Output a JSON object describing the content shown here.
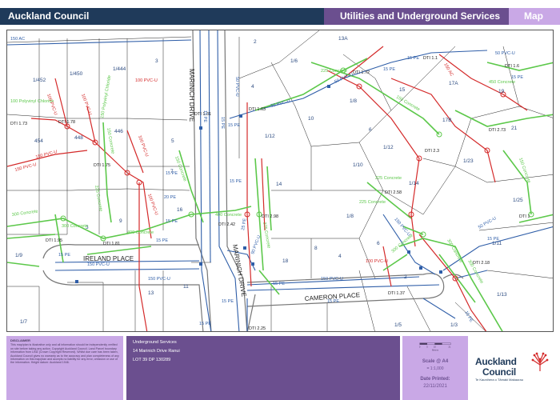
{
  "header": {
    "org": "Auckland Council",
    "title": "Utilities and Underground Services",
    "tag": "Map"
  },
  "map": {
    "roads": [
      "MARINICH DRIVE",
      "MARINICH DRIVE",
      "IRELAND PLACE",
      "CAMERON PLACE"
    ],
    "parcels": [
      "13A",
      "2",
      "1/6",
      "1/452",
      "1/450",
      "1/444",
      "3",
      "4",
      "1/8",
      "15",
      "17A",
      "17B",
      "19",
      "1/12",
      "10",
      "6",
      "21",
      "454",
      "448",
      "446",
      "5",
      "7",
      "1/23",
      "1/12",
      "1/10",
      "14",
      "16",
      "1/14",
      "1/25",
      "1/8",
      "9",
      "3",
      "18",
      "8",
      "6",
      "4",
      "2",
      "1/9",
      "13",
      "11",
      "1/11",
      "1/13",
      "1/5",
      "1/3",
      "1/7"
    ],
    "services": [
      "150 AC",
      "150 AC",
      "100 Polyvinyl Chloride",
      "100 PVC-U",
      "100 PVC-U",
      "100 PVC-U",
      "150 PVC-U",
      "150 PVC-U",
      "150 PVC-U",
      "100 PVC-U",
      "100 PVC-U",
      "100 PVC-U",
      "225 Concrete",
      "300 Concrete",
      "300 Concrete",
      "400 Concrete",
      "400 Concrete",
      "375 Concrete",
      "150 Concrete",
      "225 Concrete",
      "225 Concrete",
      "150 Concrete",
      "150 Concrete",
      "150 Concrete",
      "300 Concrete",
      "450 Concrete",
      "50 PVC-U",
      "50 PVC-U",
      "90 PVC-U",
      "150 Polyvinyl Chloride",
      "50 PVC-U",
      "15 PE",
      "15 PE",
      "15 PE",
      "15 PE",
      "15 PE",
      "15 PE",
      "15 PE",
      "15 PE",
      "15 PE",
      "15 PE",
      "15 PE",
      "15 PE",
      "15 PE",
      "15 PE",
      "15 PE",
      "15 PE",
      "15 PE",
      "20 PE",
      "25 PE",
      "150 PVC-U",
      "150 PVC-U",
      "150 PVC-U",
      "50 PVC-U",
      "50 PVC-U",
      "300 Concrete",
      "300 Concrete",
      "225 Concrete"
    ],
    "dti": [
      "DTI 1.78",
      "DTI 1.73",
      "DTI 1.75",
      "DTI 1.31",
      "DTI 1.63",
      "DTI 1.72",
      "DTI 1.1",
      "DTI 1.6",
      "DTI 2.73",
      "DTI 2.3",
      "DTI 2.58",
      "DTI 2.98",
      "DTI 2.42",
      "DTI 1.95",
      "DTI 1.81",
      "DTI 1.37",
      "DTI 2.18",
      "DTI 1",
      "DTI 2.25"
    ]
  },
  "footer": {
    "disclaimer_title": "DISCLAIMER",
    "disclaimer_text": "This map/plan is illustrative only and all information should be independently verified on site before taking any action. Copyright Auckland Council. Land Parcel boundary information from LINZ (Crown Copyright Reserved). Whilst due care has been taken, Auckland Council gives no warranty as to the accuracy and plan completeness of any information on this map/plan and accepts no liability for any error, omission or use of the information. Height datum: Auckland 1946.",
    "section_title": "Underground Services",
    "address": "14 Marinich Drive Ranui",
    "legal": "LOT 39 DP 130289",
    "scale_label": "Scale @ A4",
    "scale_value": "= 1:1,000",
    "scale_ticks": [
      "0",
      "5",
      "10",
      "21"
    ],
    "scale_units": "Meters",
    "date_label": "Date Printed:",
    "date_value": "22/11/2021",
    "logo_line1": "Auckland",
    "logo_line2": "Council",
    "logo_sub": "Te Kaunihera o Tāmaki Makaurau"
  },
  "colors": {
    "header_dark": "#1f3a5a",
    "header_purple": "#6b4f8f",
    "panel_lilac": "#c9a8e6",
    "water_blue": "#2f5ea8",
    "wastewater_red": "#d42a2a",
    "stormwater_green": "#5cc84a"
  }
}
